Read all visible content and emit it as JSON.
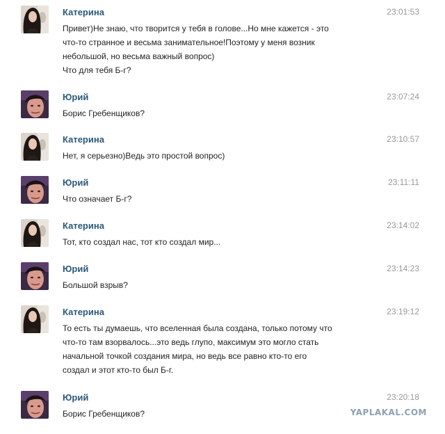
{
  "messages": [
    {
      "author": "Катерина",
      "avatar": "katerina-avatar",
      "time": "23:01:53",
      "lines": [
        "Привет)Не знаю, что творится у тебя в голове...Но мне кажется - это",
        "что-то странное и весьма занимательное!Поэтому у меня возник",
        "небольшой, но весьма важный вопрос)",
        "Что для тебя Б-г?"
      ]
    },
    {
      "author": "Юрий",
      "avatar": "yuriy-avatar",
      "time": "23:07:24",
      "lines": [
        "Борис Гребенщиков?"
      ]
    },
    {
      "author": "Катерина",
      "avatar": "katerina-avatar",
      "time": "23:10:57",
      "lines": [
        "Нет, я серьезно)Ведь это простой вопрос)"
      ]
    },
    {
      "author": "Юрий",
      "avatar": "yuriy-avatar",
      "time": "23:11:11",
      "lines": [
        "Что означает Б-г?"
      ]
    },
    {
      "author": "Катерина",
      "avatar": "katerina-avatar",
      "time": "23:14:02",
      "lines": [
        "Тот, кто создал нас, тот кто создал мир..."
      ]
    },
    {
      "author": "Юрий",
      "avatar": "yuriy-avatar",
      "time": "23:14:23",
      "lines": [
        "Большой взрыв?"
      ]
    },
    {
      "author": "Катерина",
      "avatar": "katerina-avatar",
      "time": "23:19:12",
      "lines": [
        "То есть ты думаешь, что вселенная была создана, только потому что",
        "что-то там взорвалось...это ведь глупо, максимум это могло стать",
        "начальной точкой создания мира, но ведь все равно кто-то его",
        "создал и этот кто-то был Б-г."
      ]
    },
    {
      "author": "Юрий",
      "avatar": "yuriy-avatar",
      "time": "23:20:18",
      "lines": [
        "Борис Гребенщиков?"
      ]
    }
  ],
  "watermark": "YAPLAKAL.COM",
  "colors": {
    "author": "#2b587a",
    "time": "#999999",
    "text": "#222222",
    "watermark": "#8e9fb3"
  }
}
